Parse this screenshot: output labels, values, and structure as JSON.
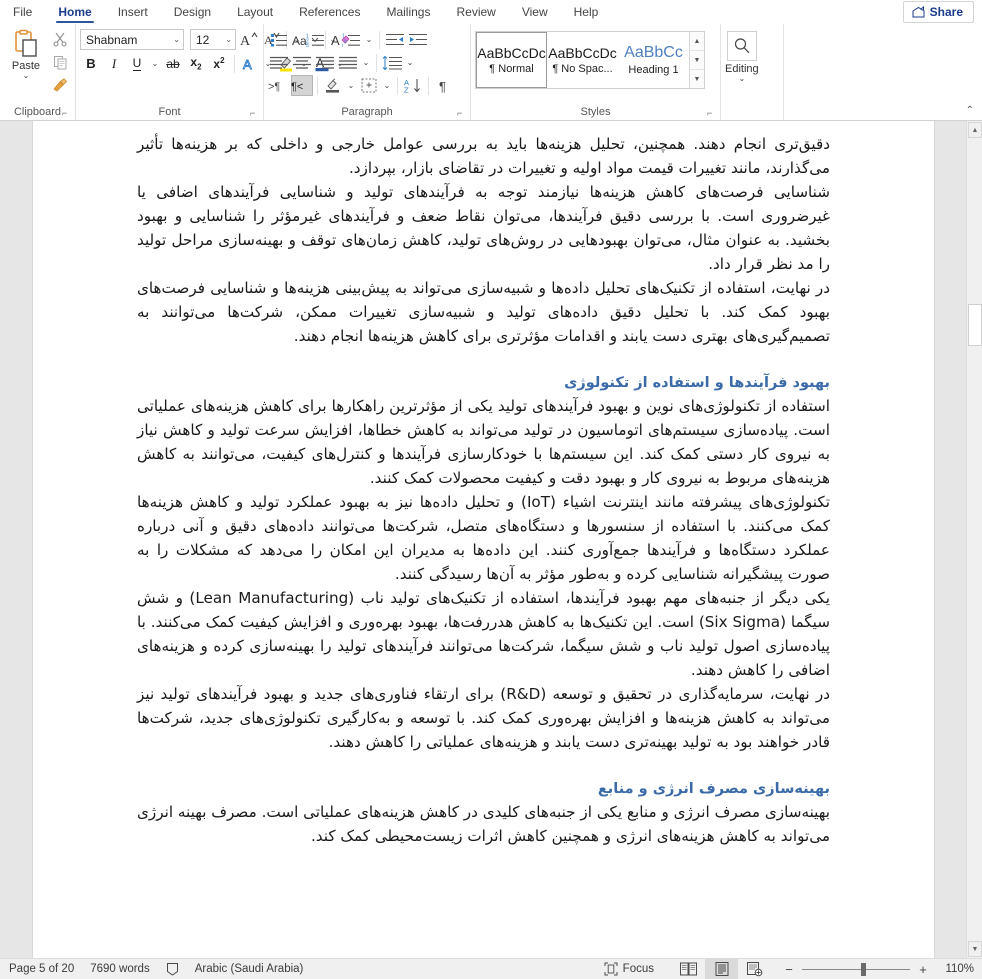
{
  "window": {
    "tabs": [
      {
        "label": "File",
        "active": false
      },
      {
        "label": "Home",
        "active": true
      },
      {
        "label": "Insert",
        "active": false
      },
      {
        "label": "Design",
        "active": false
      },
      {
        "label": "Layout",
        "active": false
      },
      {
        "label": "References",
        "active": false
      },
      {
        "label": "Mailings",
        "active": false
      },
      {
        "label": "Review",
        "active": false
      },
      {
        "label": "View",
        "active": false
      },
      {
        "label": "Help",
        "active": false
      }
    ],
    "share_label": "Share",
    "share_icon": "share-icon"
  },
  "ribbon": {
    "clipboard": {
      "group_label": "Clipboard",
      "paste_label": "Paste",
      "paste_icon": "paste-icon",
      "cut_icon": "scissors-icon",
      "copy_icon": "copy-icon",
      "format_painter_icon": "format-painter-icon",
      "dialog_launcher_icon": "dialog-launcher-icon"
    },
    "font": {
      "group_label": "Font",
      "font_name": "Shabnam",
      "font_size": "12",
      "grow_font_icon": "grow-font-icon",
      "shrink_font_icon": "shrink-font-icon",
      "change_case_icon": "change-case-icon",
      "clear_formatting_icon": "clear-formatting-icon",
      "bold_label": "B",
      "italic_label": "I",
      "underline_label": "U",
      "strikethrough_label": "ab",
      "subscript_label": "x",
      "superscript_label": "x",
      "text_effects_icon": "text-effects-icon",
      "highlight_icon": "highlight-color-icon",
      "font_color_icon": "font-color-icon",
      "dialog_launcher_icon": "dialog-launcher-icon"
    },
    "paragraph": {
      "group_label": "Paragraph",
      "bullets_icon": "bullets-icon",
      "numbering_icon": "numbering-icon",
      "multilevel_icon": "multilevel-list-icon",
      "decrease_indent_icon": "decrease-indent-icon",
      "increase_indent_icon": "increase-indent-icon",
      "align_left_icon": "align-left-icon",
      "align_center_icon": "align-center-icon",
      "align_right_icon": "align-right-icon",
      "justify_icon": "justify-icon",
      "line_spacing_icon": "line-spacing-icon",
      "ltr_icon": "left-to-right-icon",
      "rtl_icon": "right-to-left-icon",
      "shading_icon": "shading-icon",
      "borders_icon": "borders-icon",
      "sort_icon": "sort-icon",
      "show_marks_icon": "show-paragraph-marks-icon",
      "dialog_launcher_icon": "dialog-launcher-icon"
    },
    "styles": {
      "group_label": "Styles",
      "items": [
        {
          "preview": "AaBbCcDc",
          "name": "¶ Normal",
          "selected": true
        },
        {
          "preview": "AaBbCcDc",
          "name": "¶ No Spac...",
          "selected": false
        },
        {
          "preview": "AaBbCс",
          "name": "Heading 1",
          "selected": false
        }
      ],
      "scroll_up_icon": "chevron-up-icon",
      "scroll_down_icon": "chevron-down-icon",
      "more_icon": "more-styles-icon",
      "dialog_launcher_icon": "dialog-launcher-icon"
    },
    "editing": {
      "group_label": "",
      "label": "Editing",
      "icon": "search-icon",
      "chevron_icon": "chevron-down-icon"
    },
    "collapse_icon": "collapse-ribbon-icon"
  },
  "document": {
    "paragraphs": [
      {
        "type": "body",
        "text": "دقیق‌تری انجام دهند. همچنین، تحلیل هزینه‌ها باید به بررسی عوامل خارجی و داخلی که بر هزینه‌ها تأثیر می‌گذارند، مانند تغییرات قیمت مواد اولیه و تغییرات در تقاضای بازار، بپردازد."
      },
      {
        "type": "body",
        "text": "شناسایی فرصت‌های کاهش هزینه‌ها نیازمند توجه به فرآیندهای تولید و شناسایی فرآیندهای اضافی یا غیرضروری است. با بررسی دقیق فرآیندها، می‌توان نقاط ضعف و فرآیندهای غیرمؤثر را شناسایی و بهبود بخشید. به عنوان مثال، می‌توان بهبودهایی در روش‌های تولید، کاهش زمان‌های توقف و بهینه‌سازی مراحل تولید را مد نظر قرار داد."
      },
      {
        "type": "body",
        "text": "در نهایت، استفاده از تکنیک‌های تحلیل داده‌ها و شبیه‌سازی می‌تواند به پیش‌بینی هزینه‌ها و شناسایی فرصت‌های بهبود کمک کند. با تحلیل دقیق داده‌های تولید و شبیه‌سازی تغییرات ممکن، شرکت‌ها می‌توانند به تصمیم‌گیری‌های بهتری دست یابند و اقدامات مؤثرتری برای کاهش هزینه‌ها انجام دهند."
      },
      {
        "type": "heading",
        "text": "بهبود فرآیندها و استفاده از تکنولوژی"
      },
      {
        "type": "body",
        "text": "استفاده از تکنولوژی‌های نوین و بهبود فرآیندهای تولید یکی از مؤثرترین راهکارها برای کاهش هزینه‌های عملیاتی است. پیاده‌سازی سیستم‌های اتوماسیون در تولید می‌تواند به کاهش خطاها، افزایش سرعت تولید و کاهش نیاز به نیروی کار دستی کمک کند. این سیستم‌ها با خودکارسازی فرآیندها و کنترل‌های کیفیت، می‌توانند به کاهش هزینه‌های مربوط به نیروی کار و بهبود دقت و کیفیت محصولات کمک کنند."
      },
      {
        "type": "body",
        "text": "تکنولوژی‌های پیشرفته مانند اینترنت اشیاء (IoT) و تحلیل داده‌ها نیز به بهبود عملکرد تولید و کاهش هزینه‌ها کمک می‌کنند. با استفاده از سنسورها و دستگاه‌های متصل، شرکت‌ها می‌توانند داده‌های دقیق و آنی درباره عملکرد دستگاه‌ها و فرآیندها جمع‌آوری کنند. این داده‌ها به مدیران این امکان را می‌دهد که مشکلات را به صورت پیشگیرانه شناسایی کرده و به‌طور مؤثر به آن‌ها رسیدگی کنند."
      },
      {
        "type": "body",
        "text": "یکی دیگر از جنبه‌های مهم بهبود فرآیندها، استفاده از تکنیک‌های تولید ناب (Lean Manufacturing) و شش سیگما (Six Sigma) است. این تکنیک‌ها به کاهش هدررفت‌ها، بهبود بهره‌وری و افزایش کیفیت کمک می‌کنند. با پیاده‌سازی اصول تولید ناب و شش سیگما، شرکت‌ها می‌توانند فرآیندهای تولید را بهینه‌سازی کرده و هزینه‌های اضافی را کاهش دهند."
      },
      {
        "type": "body",
        "text": "در نهایت، سرمایه‌گذاری در تحقیق و توسعه (R&D) برای ارتقاء فناوری‌های جدید و بهبود فرآیندهای تولید نیز می‌تواند به کاهش هزینه‌ها و افزایش بهره‌وری کمک کند. با توسعه و به‌کارگیری تکنولوژی‌های جدید، شرکت‌ها قادر خواهند بود به تولید بهینه‌تری دست یابند و هزینه‌های عملیاتی را کاهش دهند."
      },
      {
        "type": "heading",
        "text": "بهینه‌سازی مصرف انرژی و منابع"
      },
      {
        "type": "body",
        "text": "بهینه‌سازی مصرف انرژی و منابع یکی از جنبه‌های کلیدی در کاهش هزینه‌های عملیاتی است. مصرف بهینه انرژی می‌تواند به کاهش هزینه‌های انرژی و همچنین کاهش اثرات زیست‌محیطی کمک کند."
      }
    ],
    "heading_color": "#3a6ba8"
  },
  "statusbar": {
    "page_info": "Page 5 of 20",
    "word_count": "7690 words",
    "proofing_icon": "proofing-errors-icon",
    "language": "Arabic (Saudi Arabia)",
    "focus_label": "Focus",
    "focus_icon": "focus-mode-icon",
    "read_mode_icon": "read-mode-icon",
    "print_layout_icon": "print-layout-icon",
    "web_layout_icon": "web-layout-icon",
    "zoom_out_label": "−",
    "zoom_in_label": "+",
    "zoom_level": "110%"
  }
}
